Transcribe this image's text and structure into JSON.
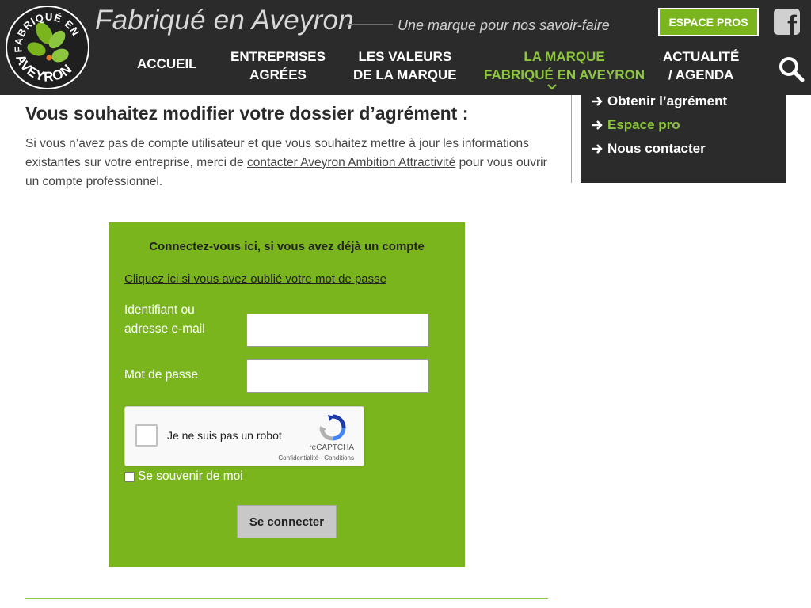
{
  "header": {
    "logo": {
      "top_text": "FABRIQUÉ EN",
      "bottom_text": "AVEYRON"
    },
    "site_title": "Fabriqué en Aveyron",
    "tagline": "Une marque pour nos savoir-faire",
    "espace_pros_label": "ESPACE PROS",
    "facebook_letter": "f",
    "nav": [
      {
        "line1": "ACCUEIL",
        "line2": ""
      },
      {
        "line1": "ENTREPRISES",
        "line2": "AGRÉES"
      },
      {
        "line1": "LES VALEURS",
        "line2": "DE LA MARQUE"
      },
      {
        "line1": "LA MARQUE",
        "line2": "FABRIQUÉ EN AVEYRON"
      },
      {
        "line1": "ACTUALITÉ",
        "line2": "/ AGENDA"
      }
    ],
    "icons": {
      "search": "search-icon",
      "facebook": "facebook-icon",
      "active_marker": "chevron-down-icon"
    }
  },
  "sidebar": {
    "items": [
      {
        "label": "Obtenir l’agrément"
      },
      {
        "label": "Espace pro"
      },
      {
        "label": "Nous contacter"
      }
    ],
    "icon": "arrow-right-icon"
  },
  "main": {
    "heading": "Vous souhaitez modifier votre dossier d’agrément :",
    "intro_before": "Si vous n’avez pas de compte utilisateur et que vous souhaitez mettre à jour les informations existantes sur votre entreprise, merci de ",
    "intro_link": "contacter Aveyron Ambition Attractivité",
    "intro_after": " pour vous ouvrir un compte professionnel."
  },
  "login": {
    "title": "Connectez-vous ici, si vous avez déjà un compte",
    "forgot_link": "Cliquez ici si vous avez oublié votre mot de passe",
    "username_label_1": "Identifiant ou",
    "username_label_2": "adresse e-mail",
    "username_value": "",
    "password_label": "Mot de passe",
    "password_value": "",
    "captcha": {
      "label": "Je ne suis pas un robot",
      "brand": "reCAPTCHA",
      "links": "Confidentialité - Conditions"
    },
    "remember_label": "Se souvenir de moi",
    "submit_label": "Se connecter"
  },
  "colors": {
    "header_bg": "#2b2b2b",
    "brand_green": "#7ab51d",
    "active_nav": "#8cc63f",
    "button_grey": "#c8c8c8"
  }
}
